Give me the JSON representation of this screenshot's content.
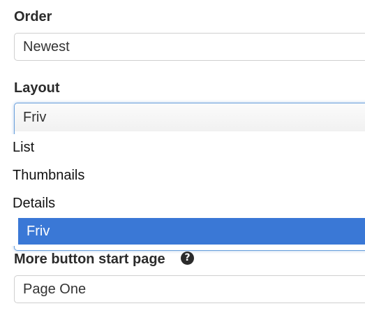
{
  "order": {
    "label": "Order",
    "value": "Newest"
  },
  "layout": {
    "label": "Layout",
    "value": "Friv",
    "options": [
      "List",
      "Thumbnails",
      "Details",
      "Friv"
    ],
    "selected_option": "Friv"
  },
  "more_button": {
    "label": "More button start page",
    "help_icon": "question-circle-icon",
    "help_glyph": "?",
    "value": "Page One"
  },
  "colors": {
    "highlight": "#3a78d6",
    "focus_border": "#6aa0dc"
  }
}
